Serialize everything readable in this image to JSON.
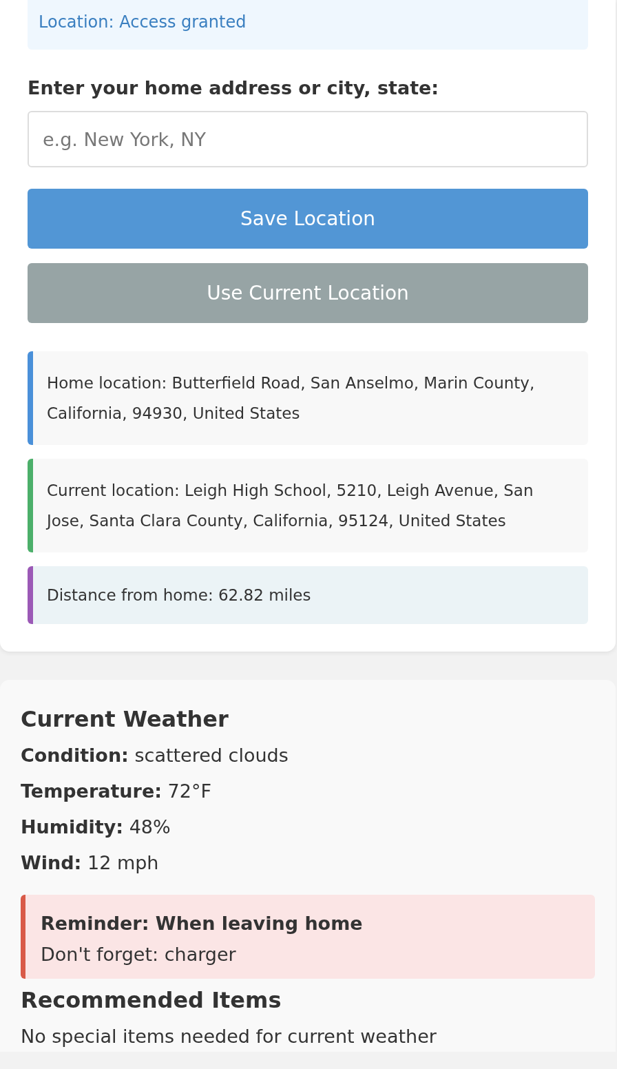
{
  "status": {
    "text": "Location: Access granted"
  },
  "home_form": {
    "label": "Enter your home address or city, state:",
    "placeholder": "e.g. New York, NY"
  },
  "buttons": [
    {
      "label": "Save Location",
      "kind": "primary"
    },
    {
      "label": "Use Current Location",
      "kind": "secondary"
    }
  ],
  "info_cards": [
    {
      "text": "Home location: Butterfield Road, San Anselmo, Marin County, California, 94930, United States",
      "color": "#4a90d9",
      "kind": "plain"
    },
    {
      "text": "Current location: Leigh High School, 5210, Leigh Avenue, San Jose, Santa Clara County, California, 95124, United States",
      "color": "#4caf6a",
      "kind": "plain"
    },
    {
      "text": "Distance from home: 62.82 miles",
      "color": "#9b59b6",
      "kind": "tinted"
    }
  ],
  "weather": {
    "title": "Current Weather",
    "lines": [
      "**Condition:** scattered clouds",
      "**Temperature:** 72°F",
      "**Humidity:** 48%",
      "**Wind:** 12 mph"
    ],
    "reminder": {
      "title": "Reminder: When leaving home",
      "text": "Don't forget: charger"
    },
    "recommended_title": "Recommended Items",
    "recommended_text": "No special items needed for current weather"
  }
}
